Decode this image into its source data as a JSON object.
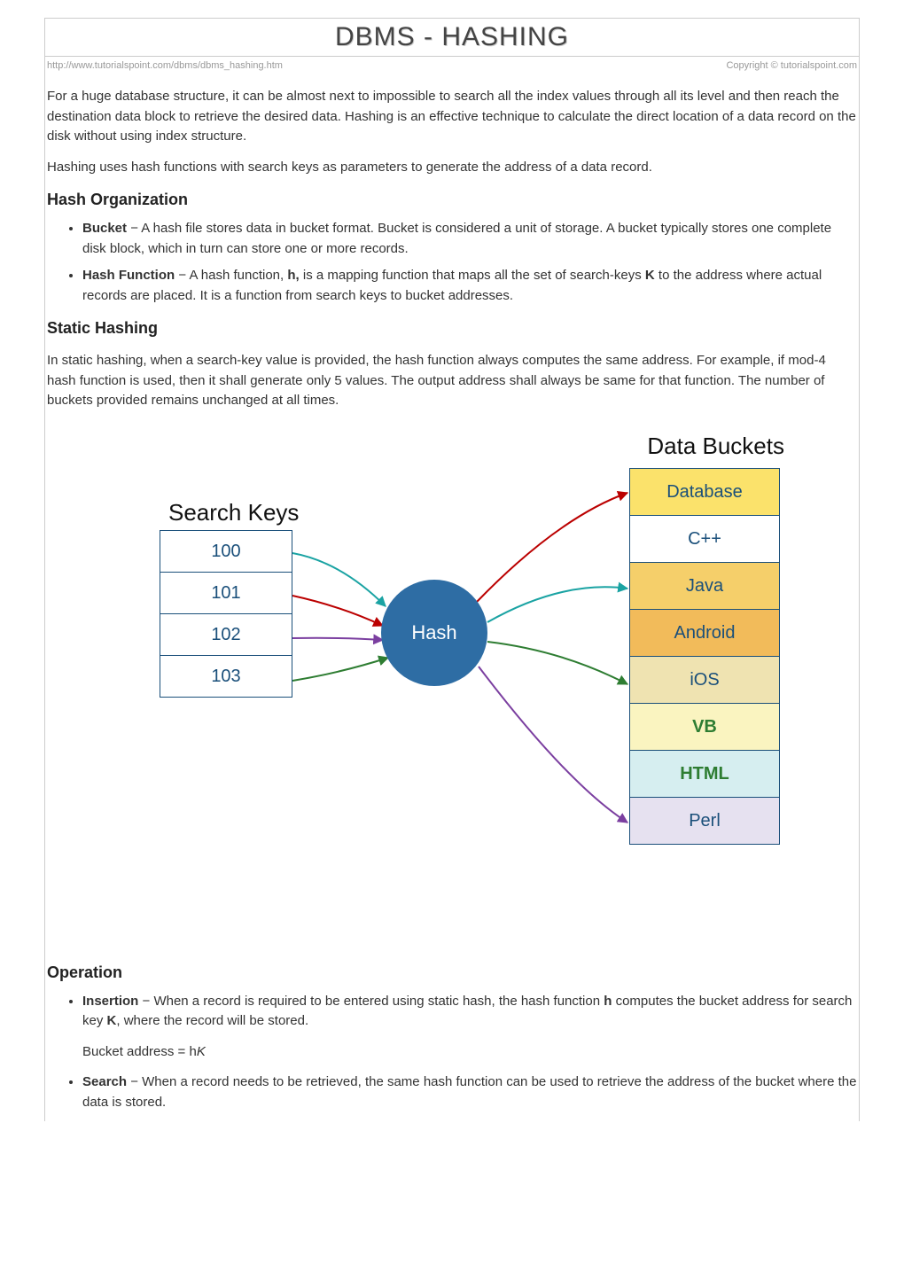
{
  "title": "DBMS - HASHING",
  "url": "http://www.tutorialspoint.com/dbms/dbms_hashing.htm",
  "copyright": "Copyright © tutorialspoint.com",
  "intro1": "For a huge database structure, it can be almost next to impossible to search all the index values through all its level and then reach the destination data block to retrieve the desired data. Hashing is an effective technique to calculate the direct location of a data record on the disk without using index structure.",
  "intro2": "Hashing uses hash functions with search keys as parameters to generate the address of a data record.",
  "h2_hashorg": "Hash Organization",
  "bucket_term": "Bucket",
  "bucket_desc": " − A hash file stores data in bucket format. Bucket is considered a unit of storage. A bucket typically stores one complete disk block, which in turn can store one or more records.",
  "hashfn_term": "Hash Function",
  "hashfn_desc_a": " − A hash function, ",
  "hashfn_h": "h,",
  "hashfn_desc_b": " is a mapping function that maps all the set of search-keys ",
  "hashfn_K": "K",
  "hashfn_desc_c": " to the address where actual records are placed. It is a function from search keys to bucket addresses.",
  "h2_static": "Static Hashing",
  "static_desc": "In static hashing, when a search-key value is provided, the hash function always computes the same address. For example, if mod-4 hash function is used, then it shall generate only 5 values. The output address shall always be same for that function. The number of buckets provided remains unchanged at all times.",
  "diagram": {
    "search_keys_label": "Search Keys",
    "data_buckets_label": "Data Buckets",
    "hash_label": "Hash",
    "keys": [
      "100",
      "101",
      "102",
      "103"
    ],
    "buckets": [
      "Database",
      "C++",
      "Java",
      "Android",
      "iOS",
      "VB",
      "HTML",
      "Perl"
    ]
  },
  "h2_operation": "Operation",
  "insertion_term": "Insertion",
  "insertion_desc_a": " − When a record is required to be entered using static hash, the hash function ",
  "insertion_h": "h",
  "insertion_desc_b": " computes the bucket address for search key ",
  "insertion_K": "K",
  "insertion_desc_c": ", where the record will be stored.",
  "formula_a": "Bucket address = h",
  "formula_b": "K",
  "search_term": "Search",
  "search_desc": " − When a record needs to be retrieved, the same hash function can be used to retrieve the address of the bucket where the data is stored."
}
